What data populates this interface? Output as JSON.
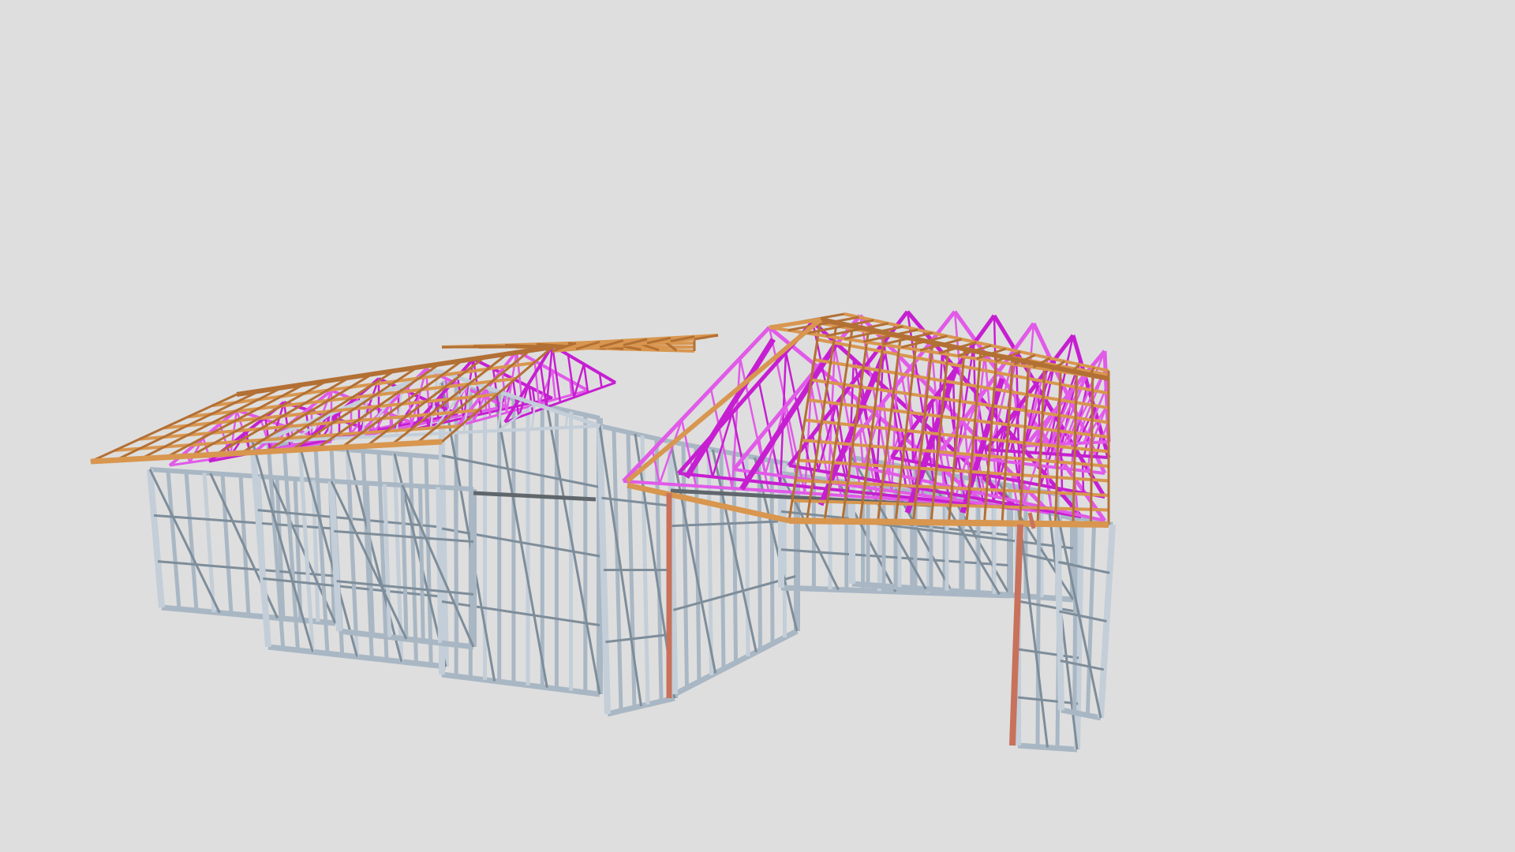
{
  "scene": {
    "background": "#dedede",
    "colors": {
      "wall_frame": "#a9b7c4",
      "wall_frame_light": "#c3ced8",
      "wall_frame_dark": "#7e8d9a",
      "roof_truss": "#c61fd1",
      "roof_truss_light": "#e15ae8",
      "roof_batten": "#d8964f",
      "roof_batten_dark": "#b37034",
      "post": "#c8725c",
      "beam": "#5f666c"
    },
    "objects": [
      "wall-frame",
      "roof-trusses",
      "roof-battens",
      "steel-posts",
      "lintel-beams"
    ]
  }
}
